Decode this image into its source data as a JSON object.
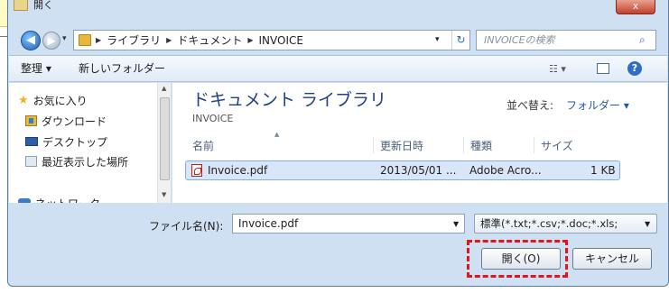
{
  "window": {
    "title": "開く",
    "close_glyph": "x"
  },
  "address": {
    "crumbs": [
      "ライブラリ",
      "ドキュメント",
      "INVOICE"
    ],
    "search_placeholder": "INVOICEの検索"
  },
  "toolbar": {
    "organize": "整理 ▾",
    "new_folder": "新しいフォルダー",
    "views_glyph": "☷ ▾",
    "help": "?"
  },
  "nav": {
    "items": [
      {
        "label": "お気に入り",
        "icon": "star-icon"
      },
      {
        "label": "ダウンロード",
        "icon": "download-folder-icon"
      },
      {
        "label": "デスクトップ",
        "icon": "desktop-icon"
      },
      {
        "label": "最近表示した場所",
        "icon": "recent-places-icon"
      },
      {
        "label": "ネットワーク",
        "icon": "network-icon"
      }
    ]
  },
  "library": {
    "title": "ドキュメント ライブラリ",
    "subtitle": "INVOICE",
    "sort_label": "並べ替え:",
    "sort_value": "フォルダー ▾"
  },
  "columns": [
    "名前",
    "更新日時",
    "種類",
    "サイズ"
  ],
  "files": [
    {
      "name": "Invoice.pdf",
      "modified": "2013/05/01 ...",
      "type": "Adobe Acro...",
      "size": "1 KB"
    }
  ],
  "bottom": {
    "filename_label": "ファイル名(N):",
    "filename_value": "Invoice.pdf",
    "filter_value": "標準(*.txt;*.csv;*.doc;*.xls;",
    "open_button": "開く(O)",
    "cancel_button": "キャンセル"
  },
  "colors": {
    "highlight": "#e4141b",
    "callout": "#fffbc4",
    "window_frame": "#cfe0f3",
    "library_title": "#1e3f8a"
  }
}
